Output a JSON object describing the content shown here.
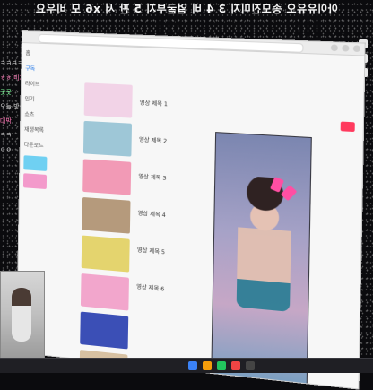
{
  "top_banner": {
    "text": "아이유유오 송모진미지 3 4 비 얼굴부지 5 판 서 x6 모 비우요",
    "color": "#ffffff"
  },
  "left_chat": [
    {
      "text": "ㅋㅋㅋㅋ",
      "color": "#dcdcdc"
    },
    {
      "text": "ㅎㅎ 미지",
      "color": "#ff7ab8"
    },
    {
      "text": "굿굿",
      "color": "#7cff9a"
    },
    {
      "text": "오늘 방송",
      "color": "#dcdcdc"
    },
    {
      "text": "대박",
      "color": "#ff7ab8"
    },
    {
      "text": "ㅋㅋ",
      "color": "#dcdcdc"
    },
    {
      "text": "ㅇㅇ",
      "color": "#dcdcdc"
    }
  ],
  "browser": {
    "url": "",
    "sidebar": [
      {
        "label": "홈",
        "highlight": false
      },
      {
        "label": "구독",
        "highlight": true
      },
      {
        "label": "라이브",
        "highlight": false
      },
      {
        "label": "인기",
        "highlight": false
      },
      {
        "label": "쇼츠",
        "highlight": false
      },
      {
        "label": "재생목록",
        "highlight": false
      },
      {
        "label": "다운로드",
        "highlight": false
      }
    ],
    "thumbs": [
      {
        "name": "thumb-1",
        "color": "#f2d3e7"
      },
      {
        "name": "thumb-2",
        "color": "#9ec7d7"
      },
      {
        "name": "thumb-3",
        "color": "#f29ab6"
      },
      {
        "name": "thumb-4",
        "color": "#b59a7c"
      },
      {
        "name": "thumb-5",
        "color": "#e4d46e"
      },
      {
        "name": "thumb-6",
        "color": "#f2a6cc"
      },
      {
        "name": "thumb-7",
        "color": "#3b4fb6"
      },
      {
        "name": "thumb-8",
        "color": "#d7c1a2"
      }
    ],
    "captions": [
      "영상 제목 1",
      "영상 제목 2",
      "영상 제목 3",
      "영상 제목 4",
      "영상 제목 5",
      "영상 제목 6"
    ],
    "main_caption": "",
    "accent": "#ff3a5e"
  },
  "taskbar": {
    "icons": [
      "folder-icon",
      "browser-icon",
      "chat-icon",
      "media-icon",
      "settings-icon"
    ]
  }
}
